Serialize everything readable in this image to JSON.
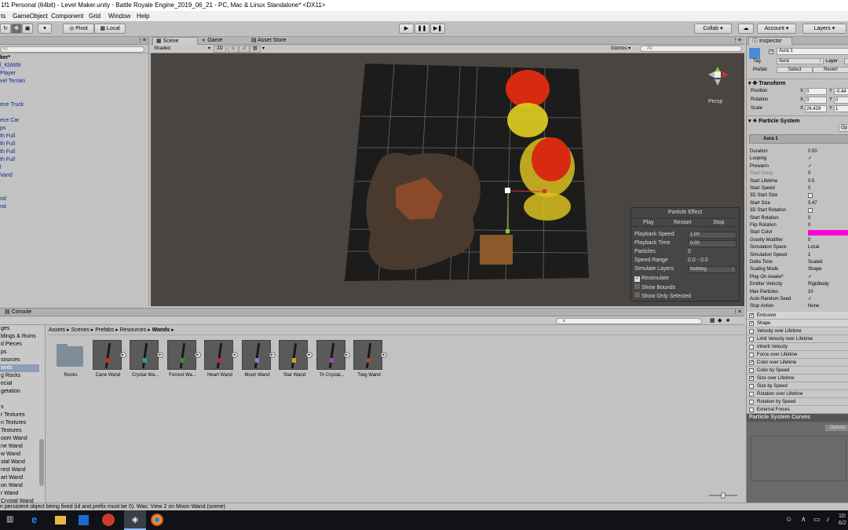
{
  "window": {
    "title": "1f1 Personal (64bit) - Level Maker.unity - Battle Royale Engine_2019_06_21 - PC, Mac & Linux Standalone* <DX11>"
  },
  "menu": [
    "ts",
    "GameObject",
    "Component",
    "Grid",
    "Window",
    "Help"
  ],
  "toolbar": {
    "pivot_label": "Pivot",
    "local_label": "Local",
    "collab_label": "Collab ▾",
    "account_label": "Account",
    "layers_label": "Layers"
  },
  "hierarchy": {
    "search_value": "All",
    "items": [
      "ker*",
      "l_KbW6t",
      "Player",
      "vel Terrain",
      "ece Truck",
      "ece Car",
      "ps",
      "th Full",
      "th Full",
      "th Full",
      "th Full",
      "l",
      "Vand",
      "nd",
      "nd"
    ]
  },
  "scene": {
    "tabs": [
      "Scene",
      "Game",
      "Asset Store"
    ],
    "shading": "Shaded",
    "mode_2d": "2D",
    "gizmos_label": "Gizmos ▾",
    "search_value": "All",
    "persp_label": "Persp"
  },
  "particle_effect": {
    "title": "Particle Effect",
    "buttons": [
      "Play",
      "Restart",
      "Stop"
    ],
    "rows": [
      {
        "label": "Playback Speed",
        "value": "1.00"
      },
      {
        "label": "Playback Time",
        "value": "0.00"
      },
      {
        "label": "Particles",
        "value": "0"
      },
      {
        "label": "Speed Range",
        "value": "0.0 - 0.0"
      },
      {
        "label": "Simulate Layers",
        "value": "Nothing"
      }
    ],
    "checkboxes": [
      {
        "label": "Resimulate",
        "checked": true
      },
      {
        "label": "Show Bounds",
        "checked": false
      },
      {
        "label": "Show Only Selected",
        "checked": false
      }
    ]
  },
  "inspector": {
    "tab_label": "Inspector",
    "object_name": "Aura 1",
    "tag_label": "Tag",
    "tag_value": "Aura",
    "layer_label": "Layer",
    "prefab_label": "Prefab",
    "select_label": "Select",
    "revert_label": "Revert",
    "transform_label": "Transform",
    "position_label": "Position",
    "rotation_label": "Rotation",
    "scale_label": "Scale",
    "pos_x": "0",
    "pos_y": "-0.44",
    "rot_x": "0",
    "rot_y": "0",
    "scale_x": "26.429",
    "scale_y": "1",
    "particle_system_label": "Particle System",
    "open_editor_label": "Op",
    "system_name": "Aura 1",
    "properties": [
      {
        "label": "Duration",
        "value": "0.50"
      },
      {
        "label": "Looping",
        "value": "✓"
      },
      {
        "label": "Prewarm",
        "value": "✓"
      },
      {
        "label": "Start Delay",
        "value": "0"
      },
      {
        "label": "Start Lifetime",
        "value": "0.5"
      },
      {
        "label": "Start Speed",
        "value": "0"
      },
      {
        "label": "3D Start Size",
        "value": ""
      },
      {
        "label": "Start Size",
        "value": "0.47"
      },
      {
        "label": "3D Start Rotation",
        "value": ""
      },
      {
        "label": "Start Rotation",
        "value": "0"
      },
      {
        "label": "Flip Rotation",
        "value": "0"
      },
      {
        "label": "Start Color",
        "value": ""
      },
      {
        "label": "Gravity Modifier",
        "value": "0"
      },
      {
        "label": "Simulation Space",
        "value": "Local"
      },
      {
        "label": "Simulation Speed",
        "value": "1"
      },
      {
        "label": "Delta Time",
        "value": "Scaled"
      },
      {
        "label": "Scaling Mode",
        "value": "Shape"
      },
      {
        "label": "Play On Awake*",
        "value": "✓"
      },
      {
        "label": "Emitter Velocity",
        "value": "Rigidbody"
      },
      {
        "label": "Max Particles",
        "value": "10"
      },
      {
        "label": "Auto Random Seed",
        "value": "✓"
      },
      {
        "label": "Stop Action",
        "value": "None"
      }
    ],
    "modules": [
      {
        "label": "Emission",
        "checked": true
      },
      {
        "label": "Shape",
        "checked": true
      },
      {
        "label": "Velocity over Lifetime",
        "checked": false
      },
      {
        "label": "Limit Velocity over Lifetime",
        "checked": false
      },
      {
        "label": "Inherit Velocity",
        "checked": false
      },
      {
        "label": "Force over Lifetime",
        "checked": false
      },
      {
        "label": "Color over Lifetime",
        "checked": true
      },
      {
        "label": "Color by Speed",
        "checked": false
      },
      {
        "label": "Size over Lifetime",
        "checked": true
      },
      {
        "label": "Size by Speed",
        "checked": false
      },
      {
        "label": "Rotation over Lifetime",
        "checked": false
      },
      {
        "label": "Rotation by Speed",
        "checked": false
      },
      {
        "label": "External Forces",
        "checked": false
      }
    ],
    "curves_label": "Particle System Curves",
    "optimize_label": "Optimiz",
    "start_color": "#ff00d8"
  },
  "project": {
    "console_tab": "Console",
    "breadcrumb": [
      "Assets",
      "Scenes",
      "Prefabs",
      "Resources",
      "Wands"
    ],
    "folders": [
      "ges",
      "ldings & Ruins",
      "d Pieces",
      "ps",
      "sources",
      "ands",
      "g Rocks",
      "ecial",
      "getation",
      "",
      "s",
      "r Textures",
      "n Textures",
      "Textures",
      "oom Wand",
      "ne Wand",
      "w Wand",
      "stal Wand",
      "rest Wand",
      "art Wand",
      "on Wand",
      "r Wand",
      "Crystal Wand"
    ],
    "selected_folder_index": 5,
    "assets": [
      {
        "name": "Rocks",
        "type": "folder"
      },
      {
        "name": "Cane Wand",
        "type": "prefab",
        "tip": "#c03030"
      },
      {
        "name": "Crystal Wa...",
        "type": "prefab",
        "tip": "#2aa0a0"
      },
      {
        "name": "Forrest Wa...",
        "type": "prefab",
        "tip": "#309040"
      },
      {
        "name": "Heart Wand",
        "type": "prefab",
        "tip": "#c02060"
      },
      {
        "name": "Moon Wand",
        "type": "prefab",
        "tip": "#8080d0"
      },
      {
        "name": "Star Wand",
        "type": "prefab",
        "tip": "#d0a020"
      },
      {
        "name": "Tri Crystal...",
        "type": "prefab",
        "tip": "#9050c0"
      },
      {
        "name": "Twig Wand",
        "type": "prefab",
        "tip": "#a05030"
      }
    ]
  },
  "status": {
    "message": "n persistent object being fixed (id and prefix must be 0). Was: View 2 on Moon Wand (scene)"
  },
  "taskbar": {
    "time": "10:",
    "date": "6/2"
  }
}
